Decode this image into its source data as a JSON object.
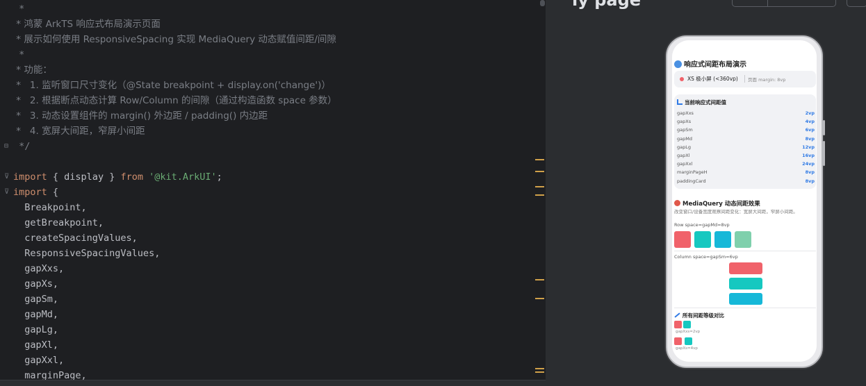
{
  "editor": {
    "lines": [
      [
        {
          "t": " *",
          "c": "com"
        }
      ],
      [
        {
          "t": " * 鸿蒙 ArkTS 响应式布局演示页面",
          "c": "com"
        }
      ],
      [
        {
          "t": " * 展示如何使用 ResponsiveSpacing 实现 MediaQuery 动态赋值间距/间隙",
          "c": "com"
        }
      ],
      [
        {
          "t": " *",
          "c": "com"
        }
      ],
      [
        {
          "t": " * 功能：",
          "c": "com"
        }
      ],
      [
        {
          "t": " *   1. 监听窗口尺寸变化（@State breakpoint + display.on('change')）",
          "c": "com"
        }
      ],
      [
        {
          "t": " *   2. 根据断点动态计算 Row/Column 的间隙（通过构造函数 space 参数）",
          "c": "com"
        }
      ],
      [
        {
          "t": " *   3. 动态设置组件的 margin() 外边距 / padding() 内边距",
          "c": "com"
        }
      ],
      [
        {
          "t": " *   4. 宽屏大间距，窄屏小间距",
          "c": "com"
        }
      ],
      [
        {
          "t": " */",
          "c": "com"
        }
      ],
      [
        {
          "t": "",
          "c": "ident"
        }
      ],
      [
        {
          "t": "import",
          "c": "kw"
        },
        {
          "t": " { ",
          "c": "br"
        },
        {
          "t": "display",
          "c": "ident"
        },
        {
          "t": " } ",
          "c": "br"
        },
        {
          "t": "from",
          "c": "kw"
        },
        {
          "t": " ",
          "c": "ident"
        },
        {
          "t": "'@kit.ArkUI'",
          "c": "str"
        },
        {
          "t": ";",
          "c": "ident"
        }
      ],
      [
        {
          "t": "import",
          "c": "kw"
        },
        {
          "t": " {",
          "c": "br"
        }
      ],
      [
        {
          "t": "  Breakpoint,",
          "c": "ident"
        }
      ],
      [
        {
          "t": "  getBreakpoint,",
          "c": "ident"
        }
      ],
      [
        {
          "t": "  createSpacingValues,",
          "c": "ident"
        }
      ],
      [
        {
          "t": "  ResponsiveSpacingValues,",
          "c": "ident"
        }
      ],
      [
        {
          "t": "  gapXxs,",
          "c": "ident"
        }
      ],
      [
        {
          "t": "  gapXs,",
          "c": "ident"
        }
      ],
      [
        {
          "t": "  gapSm,",
          "c": "ident"
        }
      ],
      [
        {
          "t": "  gapMd,",
          "c": "ident"
        }
      ],
      [
        {
          "t": "  gapLg,",
          "c": "ident"
        }
      ],
      [
        {
          "t": "  gapXl,",
          "c": "ident"
        }
      ],
      [
        {
          "t": "  gapXxl,",
          "c": "ident"
        }
      ],
      [
        {
          "t": "  marginPage,",
          "c": "ident"
        }
      ]
    ]
  },
  "preview": {
    "header_title": "ly page",
    "app": {
      "title": "响应式间距布局演示",
      "breakpoint_label": "XS 极小屏 (<360vp)",
      "page_margin_label": "页面 margin: 8vp",
      "current_spacing_title": "当前响应式间距值",
      "spacing_rows": [
        {
          "name": "gapXxs",
          "value": "2vp"
        },
        {
          "name": "gapXs",
          "value": "4vp"
        },
        {
          "name": "gapSm",
          "value": "6vp"
        },
        {
          "name": "gapMd",
          "value": "8vp"
        },
        {
          "name": "gapLg",
          "value": "12vp"
        },
        {
          "name": "gapXl",
          "value": "16vp"
        },
        {
          "name": "gapXxl",
          "value": "24vp"
        },
        {
          "name": "marginPageH",
          "value": "8vp"
        },
        {
          "name": "paddingCard",
          "value": "8vp"
        }
      ],
      "mq_title": "MediaQuery 动态间距效果",
      "mq_subtitle": "改变窗口/设备宽度观察间距变化：宽屏大间距，窄屏小间距。",
      "row_label": "Row space=gapMd=8vp",
      "column_label": "Column space=gapSm=6vp",
      "compare_title": "所有间距等级对比",
      "compare_items": [
        {
          "label": "gapXxs=2vp"
        },
        {
          "label": "gapXs=4vp"
        }
      ],
      "colors": {
        "red": "#f0626a",
        "cyan": "#16c8c0",
        "blue": "#16b8d8",
        "mint": "#7fd0ac",
        "accent": "#2f7ae5"
      }
    }
  }
}
